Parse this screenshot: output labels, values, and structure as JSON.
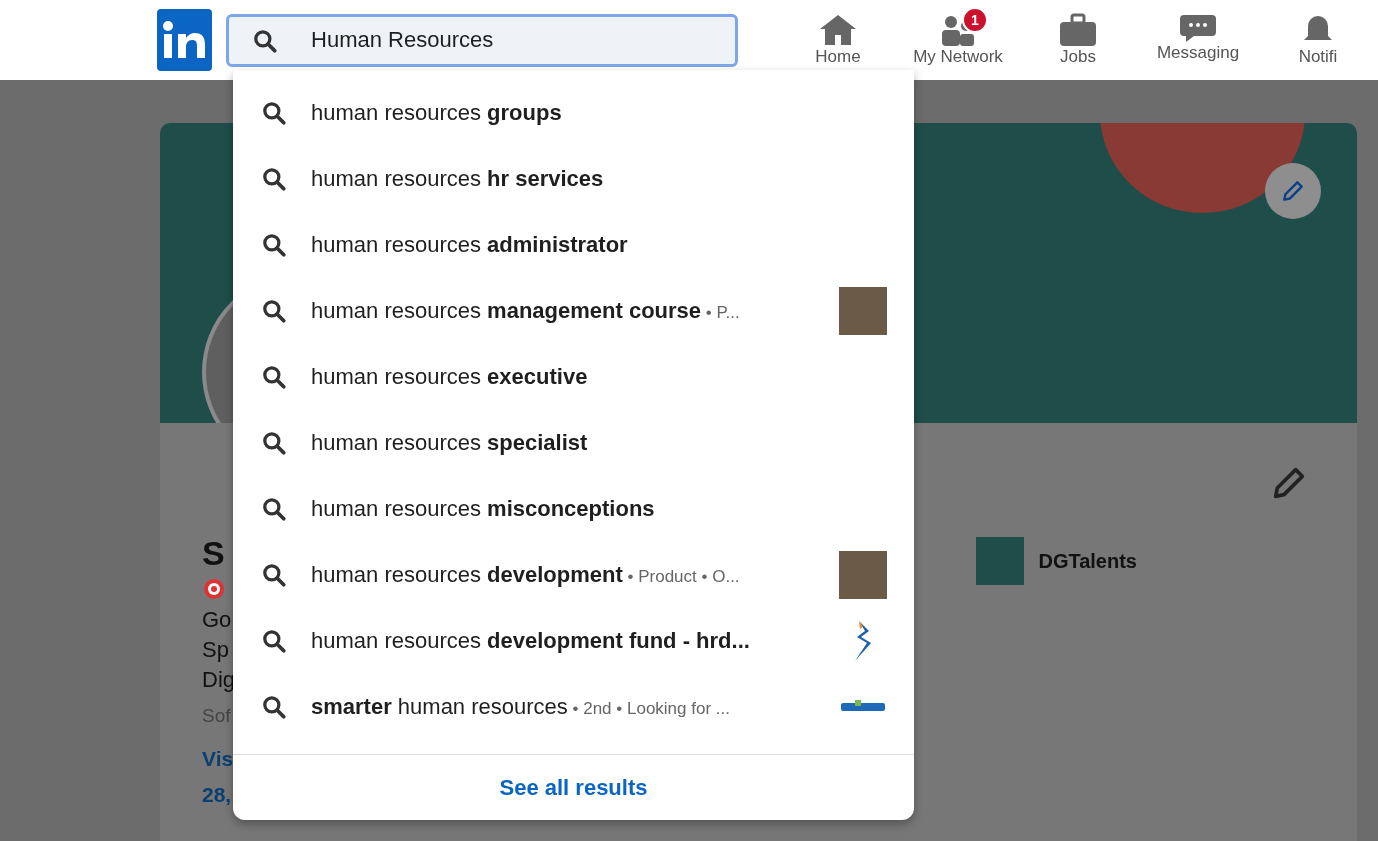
{
  "search": {
    "value": "Human Resources"
  },
  "nav": [
    {
      "label": "Home"
    },
    {
      "label": "My Network",
      "badge": "1"
    },
    {
      "label": "Jobs"
    },
    {
      "label": "Messaging"
    },
    {
      "label": "Notifi"
    }
  ],
  "suggestions": [
    {
      "text": "human resources **groups**"
    },
    {
      "text": "human resources **hr services**"
    },
    {
      "text": "human resources **administrator**"
    },
    {
      "text": "human resources **management course**",
      "meta": [
        "• P..."
      ],
      "kind": "photo"
    },
    {
      "text": "human resources **executive**"
    },
    {
      "text": "human resources **specialist**"
    },
    {
      "text": "human resources **misconceptions**"
    },
    {
      "text": "human resources **development**",
      "meta": [
        "• Product",
        "• O..."
      ],
      "kind": "photo"
    },
    {
      "text": "human resources **development fund - hrd...**",
      "kind": "mark"
    },
    {
      "text": "**smarter** human resources",
      "meta": [
        "• 2nd",
        "• Looking for ..."
      ],
      "kind": "wordmark"
    }
  ],
  "see_all": "See all results",
  "profile": {
    "name": "S",
    "headline": [
      "Go",
      "Sp",
      "Dig"
    ],
    "location": "Sof",
    "link": "Vis",
    "connections": "28,",
    "company": "DGTalents"
  }
}
